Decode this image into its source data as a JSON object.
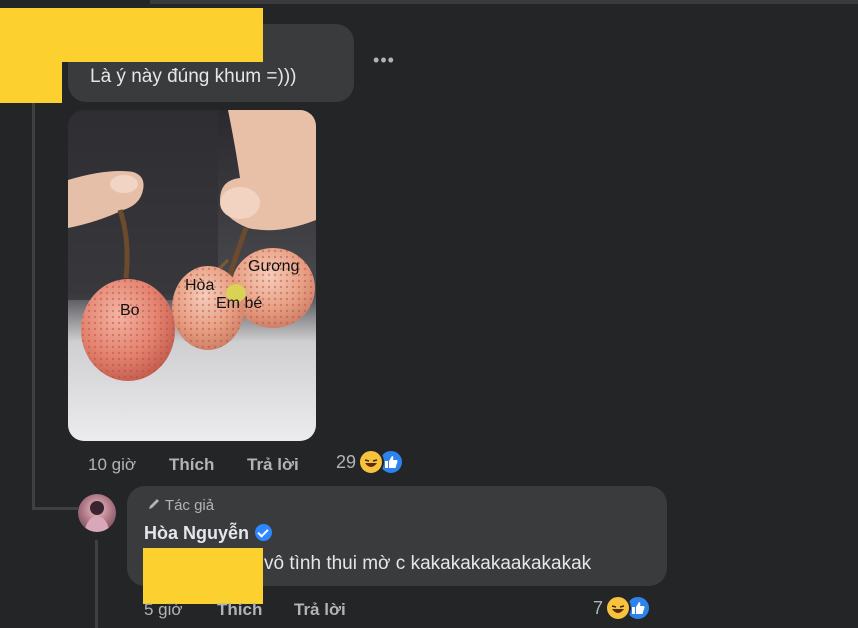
{
  "comment": {
    "text": "Là ý này đúng khum =)))",
    "more_icon": "more-dots-icon",
    "photo_labels": [
      "Bo",
      "Hòa",
      "Gương",
      "Em bé"
    ],
    "time": "10 giờ",
    "like_label": "Thích",
    "reply_label": "Trả lời",
    "reaction_count": "29",
    "reaction_icons": [
      "haha-emoji-icon",
      "like-thumb-icon"
    ]
  },
  "reply": {
    "author_tag": "Tác giả",
    "author_tag_icon": "pencil-icon",
    "author_name": "Hòa Nguyễn",
    "verified_icon": "verified-badge-icon",
    "text": "vô tình thui mờ c kakakakakaakakakak",
    "time": "5 giờ",
    "like_label": "Thích",
    "reply_label": "Trả lời",
    "reaction_count": "7",
    "reaction_icons": [
      "haha-emoji-icon",
      "like-thumb-icon"
    ]
  },
  "colors": {
    "background": "#242526",
    "bubble": "#3a3b3c",
    "text": "#e4e6eb",
    "secondary_text": "#b0b3b8",
    "redaction": "#fbd02f",
    "accent": "#2d88ff"
  }
}
